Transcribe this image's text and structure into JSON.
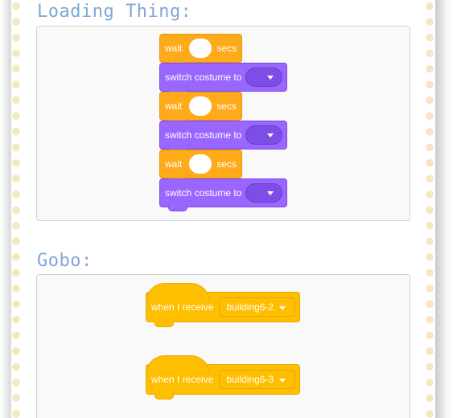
{
  "sections": [
    {
      "title": "Loading Thing:",
      "blocks": [
        {
          "kind": "wait",
          "prefix": "wait",
          "suffix": "secs"
        },
        {
          "kind": "costume",
          "label": "switch costume to"
        },
        {
          "kind": "wait",
          "prefix": "wait",
          "suffix": "secs"
        },
        {
          "kind": "costume",
          "label": "switch costume to"
        },
        {
          "kind": "wait",
          "prefix": "wait",
          "suffix": "secs"
        },
        {
          "kind": "costume",
          "label": "switch costume to"
        }
      ]
    },
    {
      "title": "Gobo:",
      "blocks": [
        {
          "kind": "hat",
          "label": "when I receive",
          "message": "building6-2"
        },
        {
          "kind": "hat",
          "label": "when I receive",
          "message": "building6-3"
        }
      ]
    }
  ],
  "colors": {
    "control": "#ffab19",
    "looks": "#9966ff",
    "events": "#ffbf00",
    "title": "#7fa8d4",
    "rail_dots": "#f6e6c2"
  },
  "icons": [
    "dropdown-arrow-icon"
  ]
}
